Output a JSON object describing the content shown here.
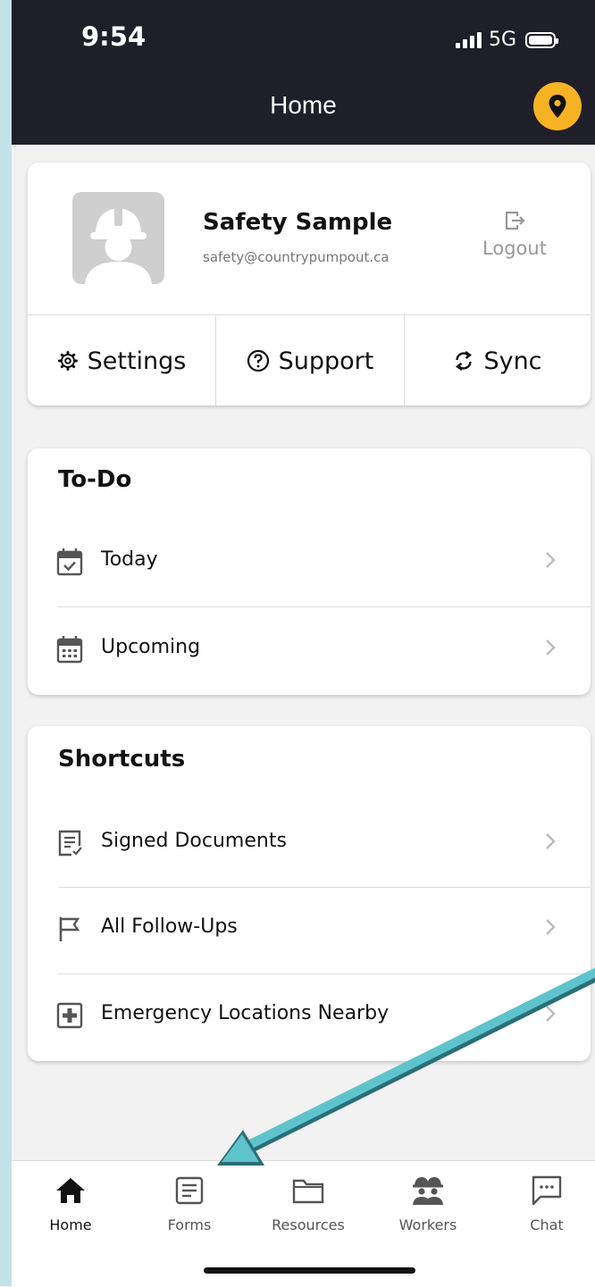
{
  "status_bar": {
    "time": "9:54",
    "network": "5G"
  },
  "header": {
    "title": "Home"
  },
  "profile": {
    "name": "Safety  Sample",
    "email": "safety@countrypumpout.ca",
    "logout_label": "Logout"
  },
  "profile_actions": [
    {
      "label": "Settings",
      "icon": "gear-icon"
    },
    {
      "label": "Support",
      "icon": "question-circle-icon"
    },
    {
      "label": "Sync",
      "icon": "sync-icon"
    }
  ],
  "todo": {
    "title": "To-Do",
    "items": [
      {
        "label": "Today",
        "icon": "calendar-check-icon"
      },
      {
        "label": "Upcoming",
        "icon": "calendar-icon"
      }
    ]
  },
  "shortcuts": {
    "title": "Shortcuts",
    "items": [
      {
        "label": "Signed Documents",
        "icon": "signed-document-icon"
      },
      {
        "label": "All Follow-Ups",
        "icon": "flag-icon"
      },
      {
        "label": "Emergency Locations Nearby",
        "icon": "first-aid-icon"
      }
    ]
  },
  "tabs": [
    {
      "label": "Home",
      "icon": "home-icon",
      "active": true
    },
    {
      "label": "Forms",
      "icon": "form-icon",
      "active": false
    },
    {
      "label": "Resources",
      "icon": "folder-icon",
      "active": false
    },
    {
      "label": "Workers",
      "icon": "workers-icon",
      "active": false
    },
    {
      "label": "Chat",
      "icon": "chat-icon",
      "active": false
    }
  ],
  "colors": {
    "header_bg": "#1f1f29",
    "accent": "#f7b323",
    "annotation_arrow": "#5fc3cc"
  }
}
